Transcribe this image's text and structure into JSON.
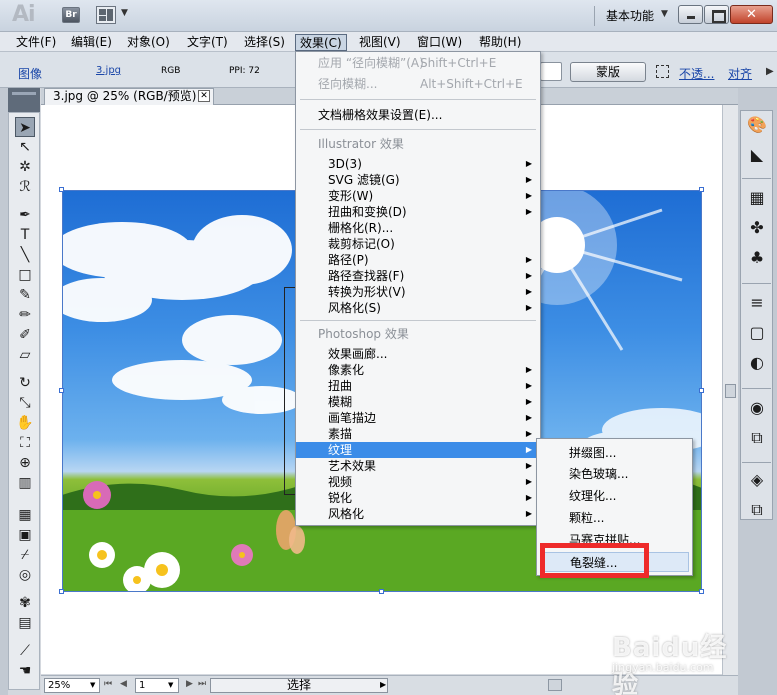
{
  "window": {
    "app_logo": "Ai",
    "bridge_label": "Br",
    "workspace": "基本功能"
  },
  "menubar": [
    {
      "label": "文件(F)"
    },
    {
      "label": "编辑(E)"
    },
    {
      "label": "对象(O)"
    },
    {
      "label": "文字(T)"
    },
    {
      "label": "选择(S)"
    },
    {
      "label": "效果(C)"
    },
    {
      "label": "视图(V)"
    },
    {
      "label": "窗口(W)"
    },
    {
      "label": "帮助(H)"
    }
  ],
  "control_bar": {
    "object_type": "图像",
    "file_name": "3.jpg",
    "color_mode": "RGB",
    "ppi": "PPI: 72",
    "mask_button": "蒙版",
    "opacity_link": "不透...",
    "align_link": "对齐"
  },
  "document": {
    "tab_title": "3.jpg @ 25% (RGB/预览)",
    "close_glyph": "✕"
  },
  "effects_menu": {
    "apply_last": {
      "label": "应用 “径向模糊”(A)",
      "shortcut": "Shift+Ctrl+E"
    },
    "last_effect": {
      "label": "径向模糊...",
      "shortcut": "Alt+Shift+Ctrl+E"
    },
    "raster_settings": "文档栅格效果设置(E)...",
    "illustrator_header": "Illustrator 效果",
    "illustrator_items": [
      "3D(3)",
      "SVG 滤镜(G)",
      "变形(W)",
      "扭曲和变换(D)",
      "栅格化(R)...",
      "裁剪标记(O)",
      "路径(P)",
      "路径查找器(F)",
      "转换为形状(V)",
      "风格化(S)"
    ],
    "photoshop_header": "Photoshop 效果",
    "photoshop_items": [
      "效果画廊...",
      "像素化",
      "扭曲",
      "模糊",
      "画笔描边",
      "素描",
      "纹理",
      "艺术效果",
      "视频",
      "锐化",
      "风格化"
    ]
  },
  "texture_submenu": {
    "items": [
      "拼缀图...",
      "染色玻璃...",
      "纹理化...",
      "颗粒...",
      "马赛克拼贴...",
      "龟裂缝..."
    ],
    "highlighted_index": 5
  },
  "status_bar": {
    "zoom": "25%",
    "artboard": "1",
    "status_text": "选择"
  },
  "watermark": {
    "text": "Baidu经验",
    "sub": "jingyan.baidu.com"
  }
}
